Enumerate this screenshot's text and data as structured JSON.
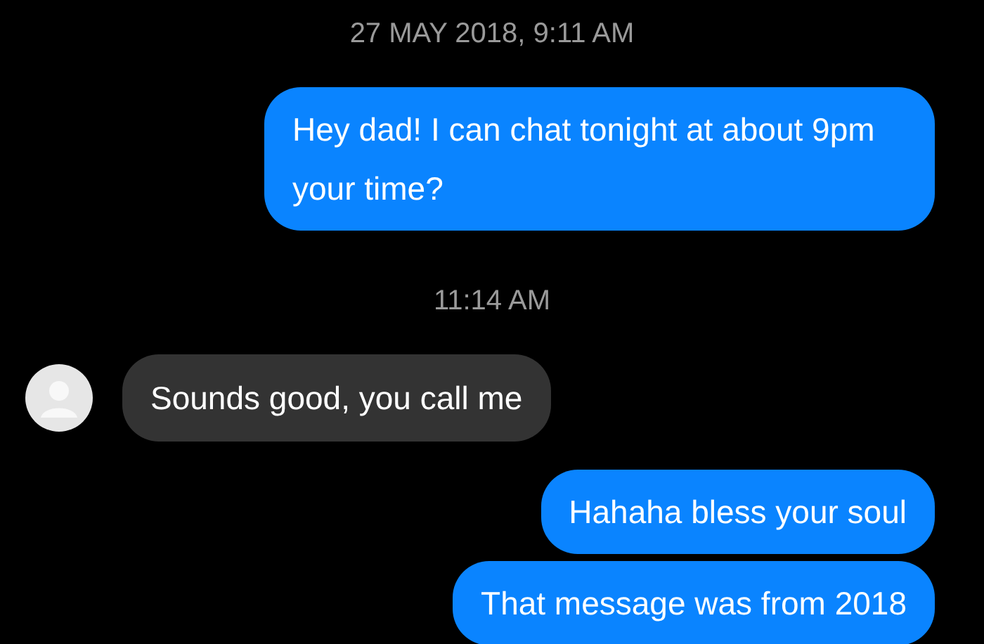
{
  "messages": [
    {
      "kind": "timestamp",
      "text": "27 MAY 2018, 9:11 AM"
    },
    {
      "kind": "sent",
      "text": "Hey dad! I can chat tonight at about 9pm your time?"
    },
    {
      "kind": "timestamp",
      "text": "11:14 AM"
    },
    {
      "kind": "received",
      "text": "Sounds good, you call me"
    },
    {
      "kind": "sent",
      "text": "Hahaha bless your soul"
    },
    {
      "kind": "sent",
      "text": "That message was from 2018"
    }
  ]
}
